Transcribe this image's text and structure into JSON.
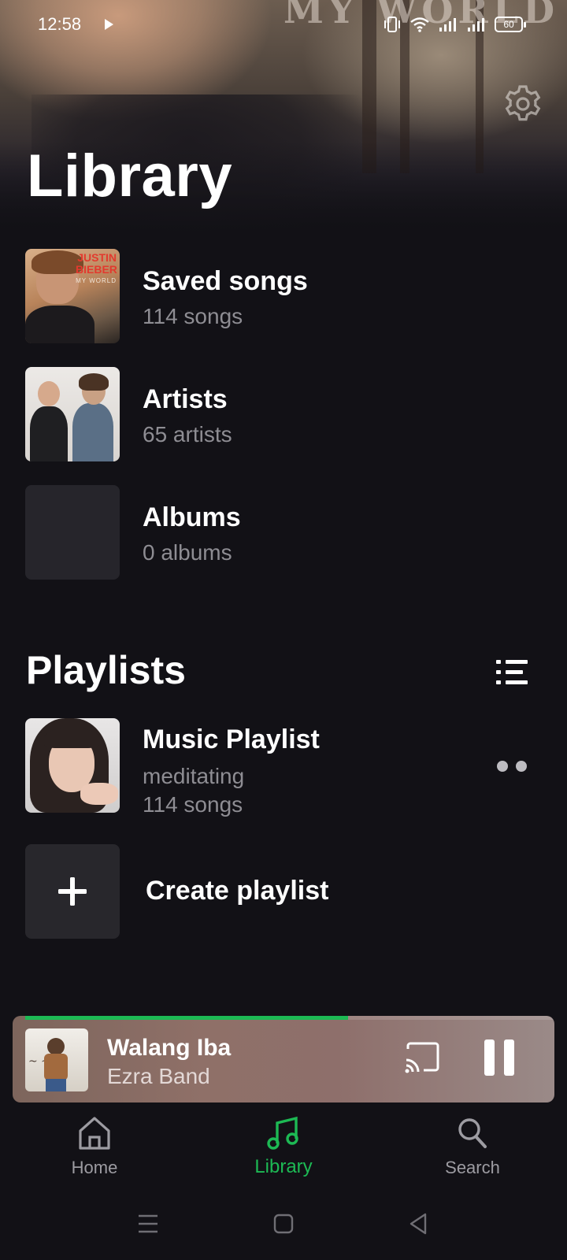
{
  "status_bar": {
    "time": "12:58",
    "battery": "60"
  },
  "hero": {
    "cover_text": "MY WORLD"
  },
  "header": {
    "title": "Library"
  },
  "library": {
    "items": [
      {
        "title": "Saved songs",
        "subtitle": "114 songs",
        "thumb_text_1": "JUSTIN BIEBER",
        "thumb_text_2": "MY WORLD"
      },
      {
        "title": "Artists",
        "subtitle": "65 artists"
      },
      {
        "title": "Albums",
        "subtitle": "0 albums"
      }
    ]
  },
  "playlists": {
    "section_title": "Playlists",
    "items": [
      {
        "title": "Music Playlist",
        "description": "meditating",
        "count": "114 songs"
      }
    ],
    "create_label": "Create playlist"
  },
  "now_playing": {
    "title": "Walang Iba",
    "artist": "Ezra Band",
    "progress": 0.61,
    "accent": "#1db954"
  },
  "bottom_nav": {
    "items": [
      {
        "label": "Home",
        "icon": "home-icon"
      },
      {
        "label": "Library",
        "icon": "music-note-icon",
        "active": true
      },
      {
        "label": "Search",
        "icon": "search-icon"
      }
    ]
  },
  "colors": {
    "background": "#121116",
    "accent": "#1db954",
    "secondary_text": "#8e8d93"
  }
}
